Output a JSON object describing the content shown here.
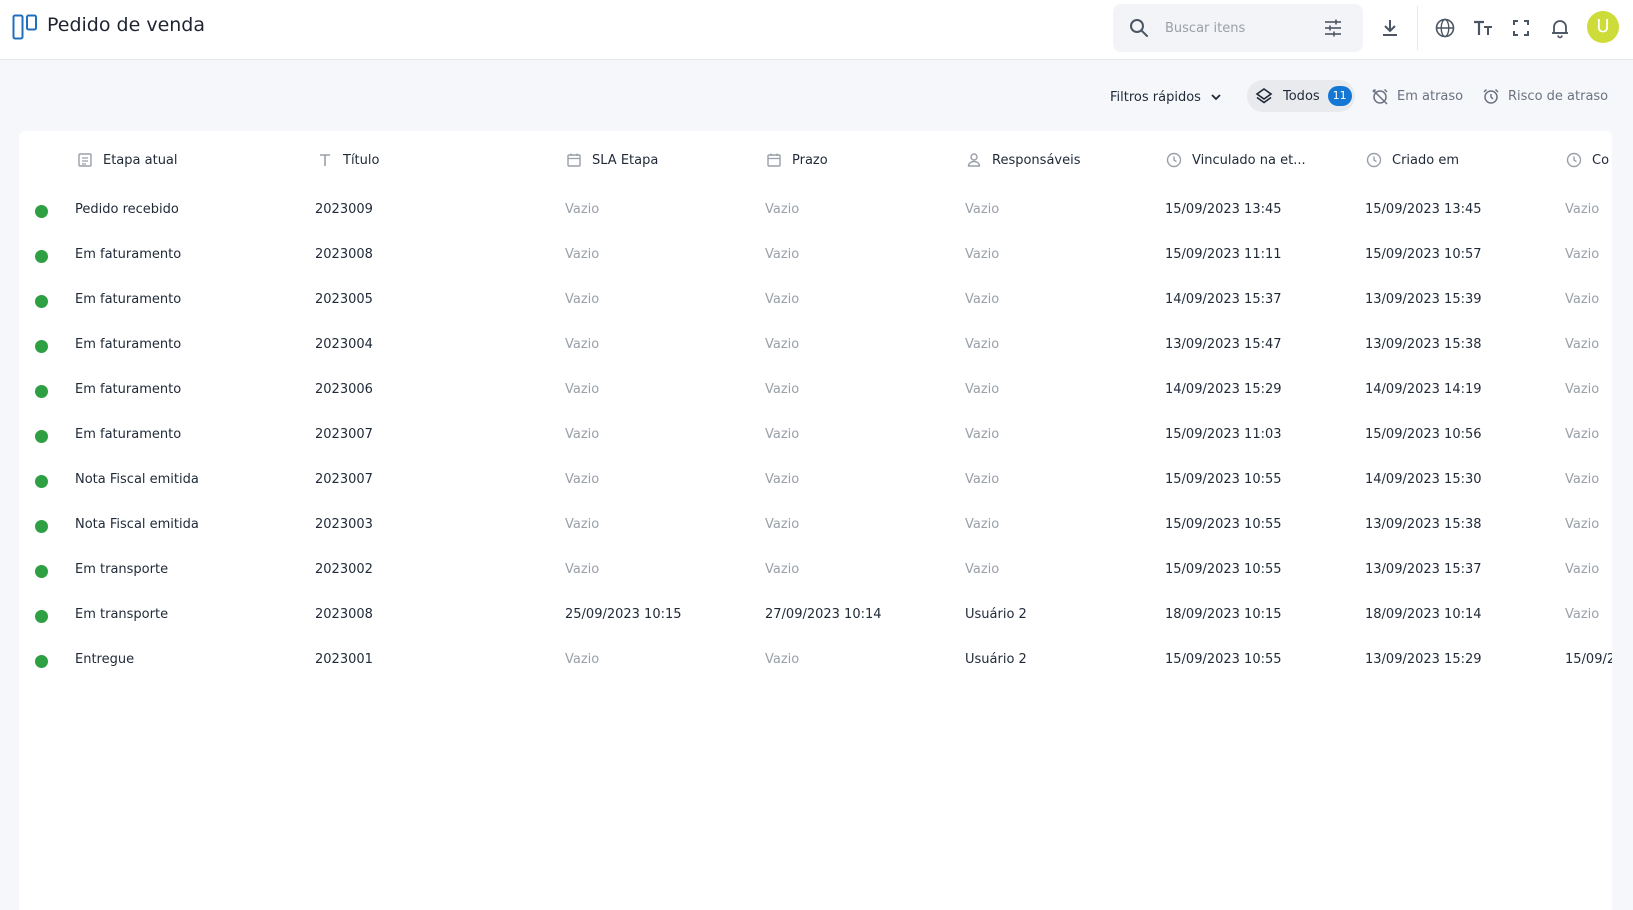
{
  "header": {
    "title": "Pedido de venda",
    "search_placeholder": "Buscar itens",
    "avatar_letter": "U"
  },
  "filters": {
    "quick_label": "Filtros rápidos",
    "todos_label": "Todos",
    "todos_count": "11",
    "atraso_label": "Em atraso",
    "risco_label": "Risco de atraso"
  },
  "table": {
    "columns": [
      "Etapa atual",
      "Título",
      "SLA Etapa",
      "Prazo",
      "Responsáveis",
      "Vinculado na et...",
      "Criado em",
      "Co"
    ],
    "rows": [
      [
        "Pedido recebido",
        "2023009",
        "Vazio",
        "Vazio",
        "Vazio",
        "15/09/2023 13:45",
        "15/09/2023 13:45",
        "Vazio"
      ],
      [
        "Em faturamento",
        "2023008",
        "Vazio",
        "Vazio",
        "Vazio",
        "15/09/2023 11:11",
        "15/09/2023 10:57",
        "Vazio"
      ],
      [
        "Em faturamento",
        "2023005",
        "Vazio",
        "Vazio",
        "Vazio",
        "14/09/2023 15:37",
        "13/09/2023 15:39",
        "Vazio"
      ],
      [
        "Em faturamento",
        "2023004",
        "Vazio",
        "Vazio",
        "Vazio",
        "13/09/2023 15:47",
        "13/09/2023 15:38",
        "Vazio"
      ],
      [
        "Em faturamento",
        "2023006",
        "Vazio",
        "Vazio",
        "Vazio",
        "14/09/2023 15:29",
        "14/09/2023 14:19",
        "Vazio"
      ],
      [
        "Em faturamento",
        "2023007",
        "Vazio",
        "Vazio",
        "Vazio",
        "15/09/2023 11:03",
        "15/09/2023 10:56",
        "Vazio"
      ],
      [
        "Nota Fiscal emitida",
        "2023007",
        "Vazio",
        "Vazio",
        "Vazio",
        "15/09/2023 10:55",
        "14/09/2023 15:30",
        "Vazio"
      ],
      [
        "Nota Fiscal emitida",
        "2023003",
        "Vazio",
        "Vazio",
        "Vazio",
        "15/09/2023 10:55",
        "13/09/2023 15:38",
        "Vazio"
      ],
      [
        "Em transporte",
        "2023002",
        "Vazio",
        "Vazio",
        "Vazio",
        "15/09/2023 10:55",
        "13/09/2023 15:37",
        "Vazio"
      ],
      [
        "Em transporte",
        "2023008",
        "25/09/2023 10:15",
        "27/09/2023 10:14",
        "Usuário 2",
        "18/09/2023 10:15",
        "18/09/2023 10:14",
        "Vazio"
      ],
      [
        "Entregue",
        "2023001",
        "Vazio",
        "Vazio",
        "Usuário 2",
        "15/09/2023 10:55",
        "13/09/2023 15:29",
        "15/09/2"
      ]
    ]
  },
  "colors": {
    "status_dot": "#2ea043",
    "accent": "#1477d4",
    "avatar": "#cddc39",
    "empty_text": "#9aa0a8"
  }
}
